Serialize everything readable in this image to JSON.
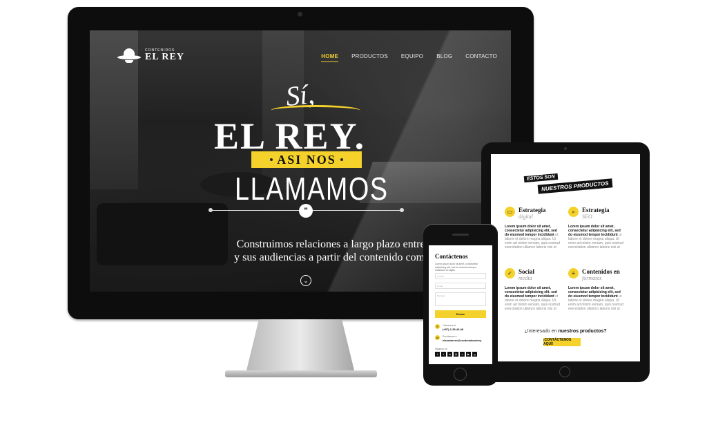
{
  "desktop": {
    "logo": {
      "small": "CONTENIDOS",
      "big": "EL REY"
    },
    "nav": [
      {
        "label": "HOME",
        "active": true
      },
      {
        "label": "PRODUCTOS"
      },
      {
        "label": "EQUIPO"
      },
      {
        "label": "BLOG"
      },
      {
        "label": "CONTACTO"
      }
    ],
    "hero": {
      "si": "Sí,",
      "title": "EL REY.",
      "ribbon": "ASI NOS",
      "title2": "LLAMAMOS",
      "quote_mark": "”",
      "copy_line1": "Construimos relaciones a largo plazo entre las marc",
      "copy_line2": "y sus audiencias a partir del contenido como estrateg",
      "scroll_icon": "chevron-down-icon"
    },
    "accent": "#f4d12b"
  },
  "tablet": {
    "tag1": "ESTOS SON",
    "tag2": "NUESTROS PRODUCTOS",
    "items": [
      {
        "name": "Estrategia",
        "sub": "digital",
        "bold": "Lorem ipsum dolor sit amet, consectetur adipisicing elit, sed do eiusmod tempor incididunt",
        "rest": " ut labore et dolore magna aliqua. Ut enim ad minim veniam, quis nostrud exercitation ullamco laboris nisi ut",
        "icon": "laptop-icon"
      },
      {
        "name": "Estrategia",
        "sub": "SEO",
        "bold": "Lorem ipsum dolor sit amet, consectetur adipisicing elit, sed do eiusmod tempor incididunt",
        "rest": " ut labore et dolore magna aliqua. Ut enim ad minim veniam, quis nostrud exercitation ullamco laboris nisi ut",
        "icon": "search-icon"
      },
      {
        "name": "Social",
        "sub": "media",
        "bold": "Lorem ipsum dolor sit amet, consectetur adipisicing elit, sed do eiusmod tempor incididunt",
        "rest": " ut labore et dolore magna aliqua. Ut enim ad minim veniam, quis nostrud exercitation ullamco laboris nisi ut",
        "icon": "thumbs-up-icon"
      },
      {
        "name": "Contenidos en",
        "sub": "formatos",
        "bold": "Lorem ipsum dolor sit amet, consectetur adipisicing elit, sed do eiusmod tempor incididunt",
        "rest": " ut labore et dolore magna aliqua. Ut enim ad minim veniam, quis nostrud exercitation ullamco laboris nisi ut",
        "icon": "document-icon"
      }
    ],
    "cta_prefix": "¿Interesado en ",
    "cta_bold": "nuestros productos?",
    "cta_button": "¡CONTÁCTENOS AQUÍ!"
  },
  "phone": {
    "title": "Contáctenos",
    "desc": "Lorem ipsum dolor sit amet, consectetur adipisicing elit, sed do eiusmod tempor incididunt ut fugitis",
    "name_placeholder": "Nombre",
    "email_placeholder": "E-mail",
    "message_placeholder": "Mensaje",
    "submit": "Enviar",
    "call_label": "Llámenos al",
    "phone_number": "(+57) 2-35-40-08",
    "write_label": "Escríbanos a",
    "email": "elsombrero@contenidoselrey",
    "follow": "Síganos en"
  }
}
